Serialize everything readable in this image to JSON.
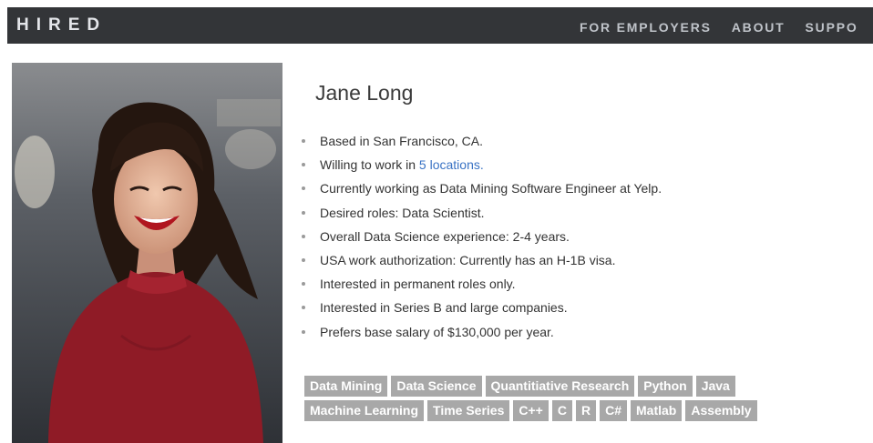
{
  "nav": {
    "logo": "HIRED",
    "links": [
      "FOR EMPLOYERS",
      "ABOUT",
      "SUPPO"
    ]
  },
  "profile": {
    "name": "Jane Long",
    "facts": [
      "Based in San Francisco, CA.",
      "Willing to work in",
      "Currently working as Data Mining Software Engineer at Yelp.",
      "Desired roles: Data Scientist.",
      "Overall Data Science experience: 2-4 years.",
      "USA work authorization: Currently has an H-1B visa.",
      "Interested in permanent roles only.",
      "Interested in Series B and large companies.",
      "Prefers base salary of $130,000 per year."
    ],
    "locations_link": "5 locations."
  },
  "skills": [
    "Data Mining",
    "Data Science",
    "Quantitiative Research",
    "Python",
    "Java",
    "Machine Learning",
    "Time Series",
    "C++",
    "C",
    "R",
    "C#",
    "Matlab",
    "Assembly"
  ],
  "colors": {
    "navbar": "#333538",
    "link": "#3a73c4",
    "tag": "#a8a8a8"
  }
}
